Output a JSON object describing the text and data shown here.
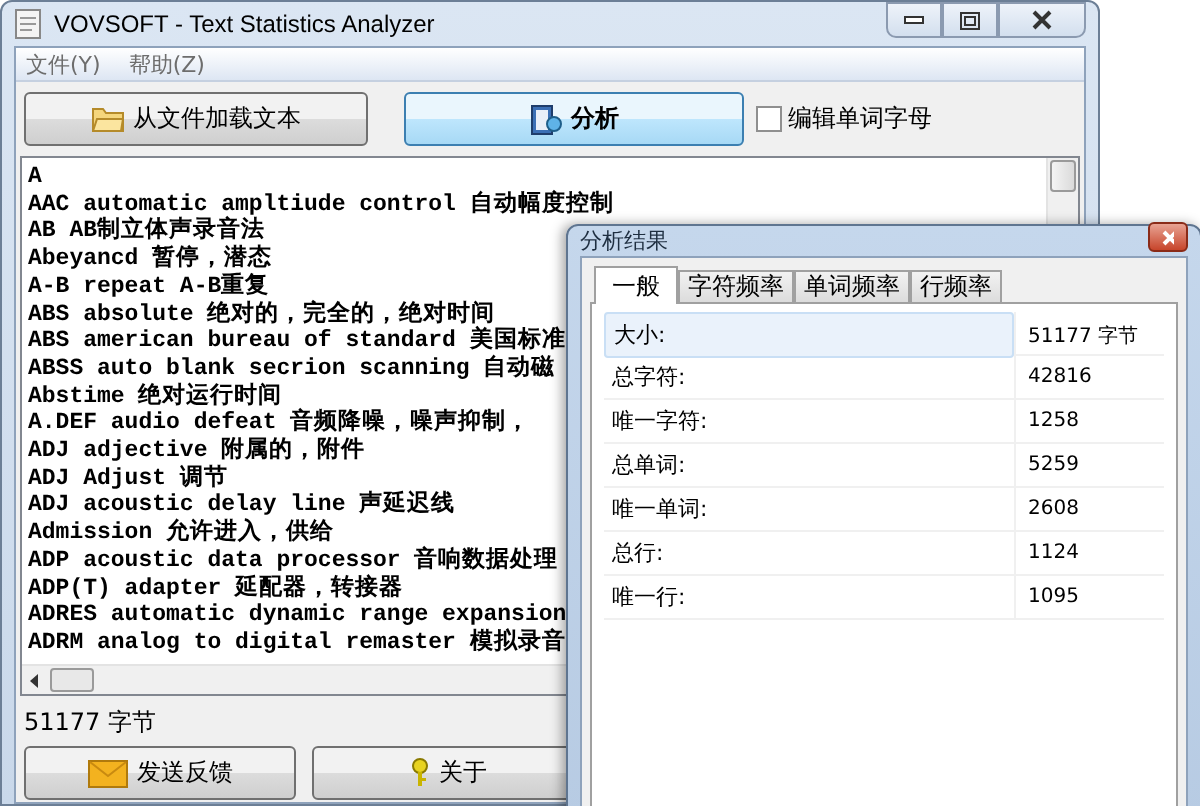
{
  "window": {
    "title": "VOVSOFT - Text Statistics Analyzer"
  },
  "menu": [
    {
      "label": "文件(Y)"
    },
    {
      "label": "帮助(Z)"
    }
  ],
  "toolbar": {
    "load_button": "从文件加载文本",
    "analyze_button": "分析",
    "edit_checkbox": {
      "label": "编辑单词字母",
      "checked": false
    }
  },
  "text_lines": [
    "A",
    "AAC automatic ampltiude control 自动幅度控制",
    "AB AB制立体声录音法",
    "Abeyancd 暂停，潜态",
    "A-B repeat A-B重复",
    "ABS absolute 绝对的，完全的，绝对时间",
    "ABS american bureau of standard 美国标准",
    "ABSS auto blank secrion scanning 自动磁",
    "Abstime 绝对运行时间",
    "A.DEF audio defeat 音频降噪，噪声抑制，",
    "ADJ adjective 附属的，附件",
    "ADJ Adjust 调节",
    "ADJ acoustic delay line 声延迟线",
    "Admission 允许进入，供给",
    "ADP acoustic data processor 音响数据处理",
    "ADP(T) adapter 延配器，转接器",
    "ADRES automatic dynamic range expansion",
    "ADRM analog to digital remaster 模拟录音"
  ],
  "status_bar": "51177 字节",
  "bottom_buttons": [
    {
      "label": "发送反馈",
      "kind": "mail"
    },
    {
      "label": "关于",
      "kind": "key"
    }
  ],
  "dialog": {
    "title": "分析结果",
    "tabs": [
      {
        "label": "一般",
        "selected": true
      },
      {
        "label": "字符频率",
        "selected": false
      },
      {
        "label": "单词频率",
        "selected": false
      },
      {
        "label": "行频率",
        "selected": false
      }
    ],
    "rows": [
      {
        "label": "大小:",
        "value": "51177 字节",
        "selected": true
      },
      {
        "label": "总字符:",
        "value": "42816",
        "selected": false
      },
      {
        "label": "唯一字符:",
        "value": "1258",
        "selected": false
      },
      {
        "label": "总单词:",
        "value": "5259",
        "selected": false
      },
      {
        "label": "唯一单词:",
        "value": "2608",
        "selected": false
      },
      {
        "label": "总行:",
        "value": "1124",
        "selected": false
      },
      {
        "label": "唯一行:",
        "value": "1095",
        "selected": false
      }
    ]
  }
}
